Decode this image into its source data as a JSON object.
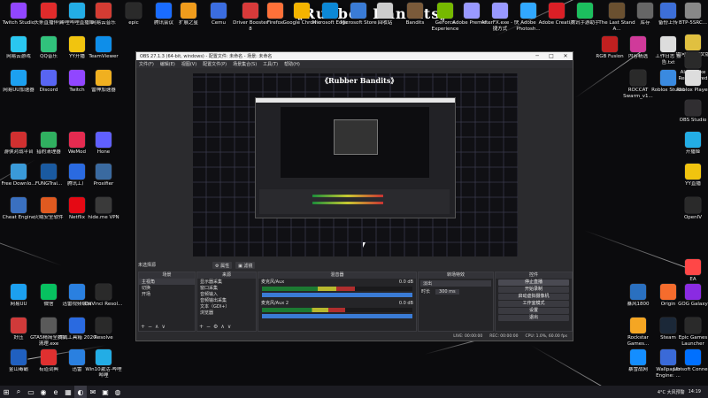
{
  "banner": "《Rubber Bandits》",
  "desktop_icons": [
    {
      "label": "Twitch Studio",
      "color": "#9146ff"
    },
    {
      "label": "头条直播伴侣",
      "color": "#e02b2b"
    },
    {
      "label": "哔哩哔哩直播姬",
      "color": "#23ade5"
    },
    {
      "label": "网易云音乐",
      "color": "#d43c33"
    },
    {
      "label": "epic",
      "color": "#2a2a2a"
    },
    {
      "label": "腾讯会议",
      "color": "#1a6cff"
    },
    {
      "label": "扩展之星",
      "color": "#f09c1c"
    },
    {
      "label": "Cemu",
      "color": "#3b6de0"
    },
    {
      "label": "Driver Booster 8",
      "color": "#d83a3a"
    },
    {
      "label": "Firefox",
      "color": "#ff7139"
    },
    {
      "label": "Google Chrome",
      "color": "#f4b400"
    },
    {
      "label": "Microsoft Edge",
      "color": "#0c88d6"
    },
    {
      "label": "Microsoft Store",
      "color": "#3a7bd5"
    },
    {
      "label": "回收站",
      "color": "#cccccc"
    },
    {
      "label": "Bandits",
      "color": "#7a5a3a"
    },
    {
      "label": "GeForce Experience",
      "color": "#76b900"
    },
    {
      "label": "Adobe Premie...",
      "color": "#9999ff"
    },
    {
      "label": "AfterFX.exe - 快捷方式",
      "color": "#9999ff"
    },
    {
      "label": "Adobe Photosh...",
      "color": "#31a8ff"
    },
    {
      "label": "Adobe Creati...",
      "color": "#da1f26"
    },
    {
      "label": "腾讯手游助手",
      "color": "#1cbf5e"
    },
    {
      "label": "The Last Stand A...",
      "color": "#6a5030"
    },
    {
      "label": "库存",
      "color": "#666666"
    },
    {
      "label": "备份上传",
      "color": "#3d6fd8"
    },
    {
      "label": "BTP-5SRC...",
      "color": "#888888"
    },
    {
      "label": "提问其位中文版",
      "color": "#e0c040"
    },
    {
      "label": "网易云游戏",
      "color": "#2ac7f0"
    },
    {
      "label": "QQ音乐",
      "color": "#31c27c"
    },
    {
      "label": "YY开播",
      "color": "#f1c40f"
    },
    {
      "label": "TeamViewer",
      "color": "#0e8ee9"
    },
    {
      "label": "Discord",
      "color": "#5865f2"
    },
    {
      "label": "Twitch",
      "color": "#9146ff"
    },
    {
      "label": "雷神加速器",
      "color": "#f0b020"
    },
    {
      "label": "网易UU加速器",
      "color": "#1ca0f0"
    },
    {
      "label": "游侠对战平台",
      "color": "#d03030"
    },
    {
      "label": "猎豹清理器",
      "color": "#30b060"
    },
    {
      "label": "WeMod",
      "color": "#e52b50"
    },
    {
      "label": "Hone",
      "color": "#6060ff"
    },
    {
      "label": "Free Downlo...",
      "color": "#3a9ad8"
    },
    {
      "label": "FUNGTrai...",
      "color": "#1a5aa0"
    },
    {
      "label": "腾讯工厂",
      "color": "#2a6ae0"
    },
    {
      "label": "Proxifier",
      "color": "#3a6aa0"
    },
    {
      "label": "Cheat Engine",
      "color": "#3a70c0"
    },
    {
      "label": "火绒安全软件",
      "color": "#e05a20"
    },
    {
      "label": "Netflix",
      "color": "#e50914"
    },
    {
      "label": "hide.me VPN",
      "color": "#3a3a3a"
    },
    {
      "label": "网易UU",
      "color": "#1ca0f0"
    },
    {
      "label": "微信",
      "color": "#07c160"
    },
    {
      "label": "迅雷视频编辑",
      "color": "#2a80e0"
    },
    {
      "label": "DaVinci Resol...",
      "color": "#2a2a2a"
    },
    {
      "label": "好压",
      "color": "#d03a3a"
    },
    {
      "label": "GTA5精简全扫描清理.exe",
      "color": "#5a5a5a"
    },
    {
      "label": "腾讯工具箱 2020",
      "color": "#2a6ae0"
    },
    {
      "label": "Resolve",
      "color": "#2a2a2a"
    },
    {
      "label": "金山毒霸",
      "color": "#2060c0"
    },
    {
      "label": "有道词典",
      "color": "#e03030"
    },
    {
      "label": "迅雷",
      "color": "#2a80e0"
    },
    {
      "label": "Win10激活-哔哩哔哩",
      "color": "#23ade5"
    },
    {
      "label": "RGB Fusion",
      "color": "#c02020"
    },
    {
      "label": "内容精选",
      "color": "#d03a9a"
    },
    {
      "label": "工作日志 报告.txt",
      "color": "#dddddd"
    },
    {
      "label": "Alan Wake Remastered",
      "color": "#2a2a2a"
    },
    {
      "label": "ROCCAT Swarm_v1...",
      "color": "#2a2a2a"
    },
    {
      "label": "Roblox Studio",
      "color": "#3a8ae0"
    },
    {
      "label": "Roblox Player",
      "color": "#dddddd"
    },
    {
      "label": "OBS Studio",
      "color": "#302e31"
    },
    {
      "label": "开播姬",
      "color": "#23ade5"
    },
    {
      "label": "YY直播",
      "color": "#f1c40f"
    },
    {
      "label": "OpenIV",
      "color": "#2a2a2a"
    },
    {
      "label": "EA",
      "color": "#ff4747"
    },
    {
      "label": "暴风1800",
      "color": "#2a70c0"
    },
    {
      "label": "Origin",
      "color": "#f56c2d"
    },
    {
      "label": "GOG Galaxy",
      "color": "#8a2be2"
    },
    {
      "label": "Rockstar Games...",
      "color": "#f5a623"
    },
    {
      "label": "Steam",
      "color": "#1b2838"
    },
    {
      "label": "Epic Games Launcher",
      "color": "#2a2a2a"
    },
    {
      "label": "暴雪战网",
      "color": "#148eff"
    },
    {
      "label": "Wallpaper Engine: ...",
      "color": "#3a6ad8"
    },
    {
      "label": "Ubisoft Connect",
      "color": "#0070ff"
    }
  ],
  "obs": {
    "title": "OBS 27.1.3 (64-bit, windows) - 配置文件: 未命名 - 场景: 未命名",
    "menu": [
      "文件(F)",
      "编辑(E)",
      "视图(V)",
      "配置文件(P)",
      "场景集合(S)",
      "工具(T)",
      "帮助(H)"
    ],
    "window_ctrls": [
      "─",
      "□",
      "✕"
    ],
    "preview_banner": "《Rubber Bandits》",
    "scene_label": "未选择源",
    "toolbar_buttons": [
      "⚙ 属性",
      "▣ 滤镜"
    ],
    "docks": {
      "scenes": {
        "title": "场景",
        "items": [
          "主视角",
          "切换",
          "开场"
        ]
      },
      "sources": {
        "title": "来源",
        "items": [
          "显示器采集",
          "窗口采集",
          "音频输入",
          "音频输出采集",
          "文本（GDI+）",
          "浏览器"
        ]
      },
      "mixer": {
        "title": "混音器",
        "tracks": [
          {
            "name": "麦克风/Aux",
            "db": "0.0 dB",
            "level": 0.62
          },
          {
            "name": "麦克风/Aux 2",
            "db": "0.0 dB",
            "level": 0.55
          }
        ]
      },
      "transitions": {
        "title": "转场特效",
        "type": "淡出",
        "duration_label": "时长",
        "duration": "300 ms"
      },
      "controls": {
        "title": "控件",
        "buttons": [
          "停止直播",
          "开始录制",
          "启动虚拟摄像机",
          "工作室模式",
          "设置",
          "退出"
        ]
      }
    },
    "status": [
      "LIVE: 00:00:00",
      "REC: 00:00:00",
      "CPU: 1.0%, 60.00 fps"
    ]
  },
  "taskbar": {
    "items": [
      "⊞",
      "⌕",
      "▭",
      "◉",
      "e",
      "▦",
      "◐",
      "✉",
      "▣",
      "◍"
    ],
    "weather": "4°C 大风预警",
    "time": "14:19"
  }
}
